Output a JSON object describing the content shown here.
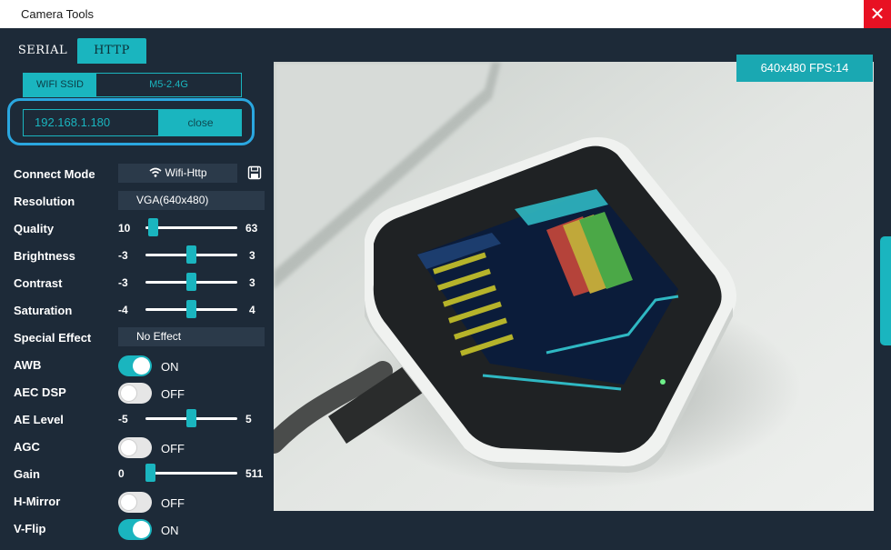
{
  "window": {
    "title": "Camera Tools",
    "close_glyph": "✕"
  },
  "tabs": [
    {
      "label": "SERIAL",
      "active": false
    },
    {
      "label": "HTTP",
      "active": true
    }
  ],
  "wifi": {
    "ssid_label": "WIFI SSID",
    "ssid_value": "M5-2.4G"
  },
  "ip": {
    "value": "192.168.1.180",
    "button_label": "close"
  },
  "settings": {
    "connect_mode": {
      "label": "Connect Mode",
      "value": "Wifi-Http",
      "icon": "wifi-icon",
      "save_icon": "save-icon"
    },
    "resolution": {
      "label": "Resolution",
      "value": "VGA(640x480)"
    },
    "quality": {
      "label": "Quality",
      "min": "10",
      "max": "63",
      "value": 12
    },
    "brightness": {
      "label": "Brightness",
      "min": "-3",
      "max": "3",
      "value": 0
    },
    "contrast": {
      "label": "Contrast",
      "min": "-3",
      "max": "3",
      "value": 0
    },
    "saturation": {
      "label": "Saturation",
      "min": "-4",
      "max": "4",
      "value": 0
    },
    "special_effect": {
      "label": "Special Effect",
      "value": "No Effect"
    },
    "awb": {
      "label": "AWB",
      "state": "ON",
      "on": true
    },
    "aec_dsp": {
      "label": "AEC DSP",
      "state": "OFF",
      "on": false
    },
    "ae_level": {
      "label": "AE Level",
      "min": "-5",
      "max": "5",
      "value": 0
    },
    "agc": {
      "label": "AGC",
      "state": "OFF",
      "on": false
    },
    "gain": {
      "label": "Gain",
      "min": "0",
      "max": "511",
      "value": 0
    },
    "h_mirror": {
      "label": "H-Mirror",
      "state": "OFF",
      "on": false
    },
    "v_flip": {
      "label": "V-Flip",
      "state": "ON",
      "on": true
    }
  },
  "camera": {
    "fps_text": "640x480 FPS:14"
  },
  "colors": {
    "accent": "#1ab5bf",
    "background": "#1d2a38",
    "highlight": "#2aa7e0",
    "close_red": "#e81123"
  }
}
